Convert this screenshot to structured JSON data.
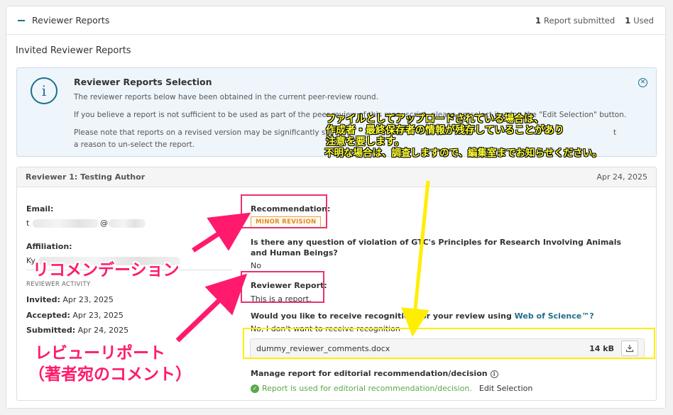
{
  "header": {
    "title": "Reviewer Reports",
    "submitted_count": "1",
    "submitted_label": "Report submitted",
    "used_count": "1",
    "used_label": "Used"
  },
  "section_title": "Invited Reviewer Reports",
  "info_box": {
    "icon": "info-circle-icon",
    "title": "Reviewer Reports Selection",
    "p1": "The reviewer reports below have been obtained in the current peer-review round.",
    "p2": "If you believe a report is not sufficient to be used as part of the peer-review of this manuscript, please un-select it using the \"Edit Selection\" button.",
    "p3a": "Please note that reports on a revised version may be significantly sh",
    "p3b": "t",
    "p3c": "a reason to un-select the report."
  },
  "reviewer": {
    "name": "Reviewer 1: Testing Author",
    "date": "Apr 24, 2025",
    "email_label": "Email:",
    "email_prefix": "t",
    "email_at": "@",
    "affiliation_label": "Affiliation:",
    "affiliation_prefix": "Ky",
    "activity_label": "REVIEWER ACTIVITY",
    "invited_label": "Invited:",
    "invited_date": "Apr 23, 2025",
    "accepted_label": "Accepted:",
    "accepted_date": "Apr 23, 2025",
    "submitted_label": "Submitted:",
    "submitted_date": "Apr 24, 2025"
  },
  "report": {
    "recommendation_label": "Recommendation:",
    "recommendation_value": "MINOR REVISION",
    "question": "Is there any question of violation of GTC's Principles for Research Involving Animals and Human Beings?",
    "answer": "No",
    "report_label": "Reviewer Report:",
    "report_text": "This is a report.",
    "recognition_question": "Would you like to receive recognition for your review using",
    "recognition_link": "Web of Science™?",
    "recognition_answer": "No, I don't want to receive recognition",
    "file_name": "dummy_reviewer_comments.docx",
    "file_size": "14 kB",
    "manage_label": "Manage report for editorial recommendation/decision",
    "used_text": "Report is used for editorial recommendation/decision.",
    "edit_selection": "Edit Selection"
  },
  "annotations": {
    "recommendation": "リコメンデーション",
    "report_line1": "レビューリポート",
    "report_line2": "（著者宛のコメント）",
    "yellow_line1": "ファイルとしてアップロードされている場合は、",
    "yellow_line2": "作成者・最終保存者の情報が残存していることがあり",
    "yellow_line3": "注意を要します。",
    "yellow_line4": "不明な場合は、調査しますので、編集室までお知らせください。",
    "pink_color": "#ff1a6e",
    "yellow_color": "#ffee00"
  }
}
